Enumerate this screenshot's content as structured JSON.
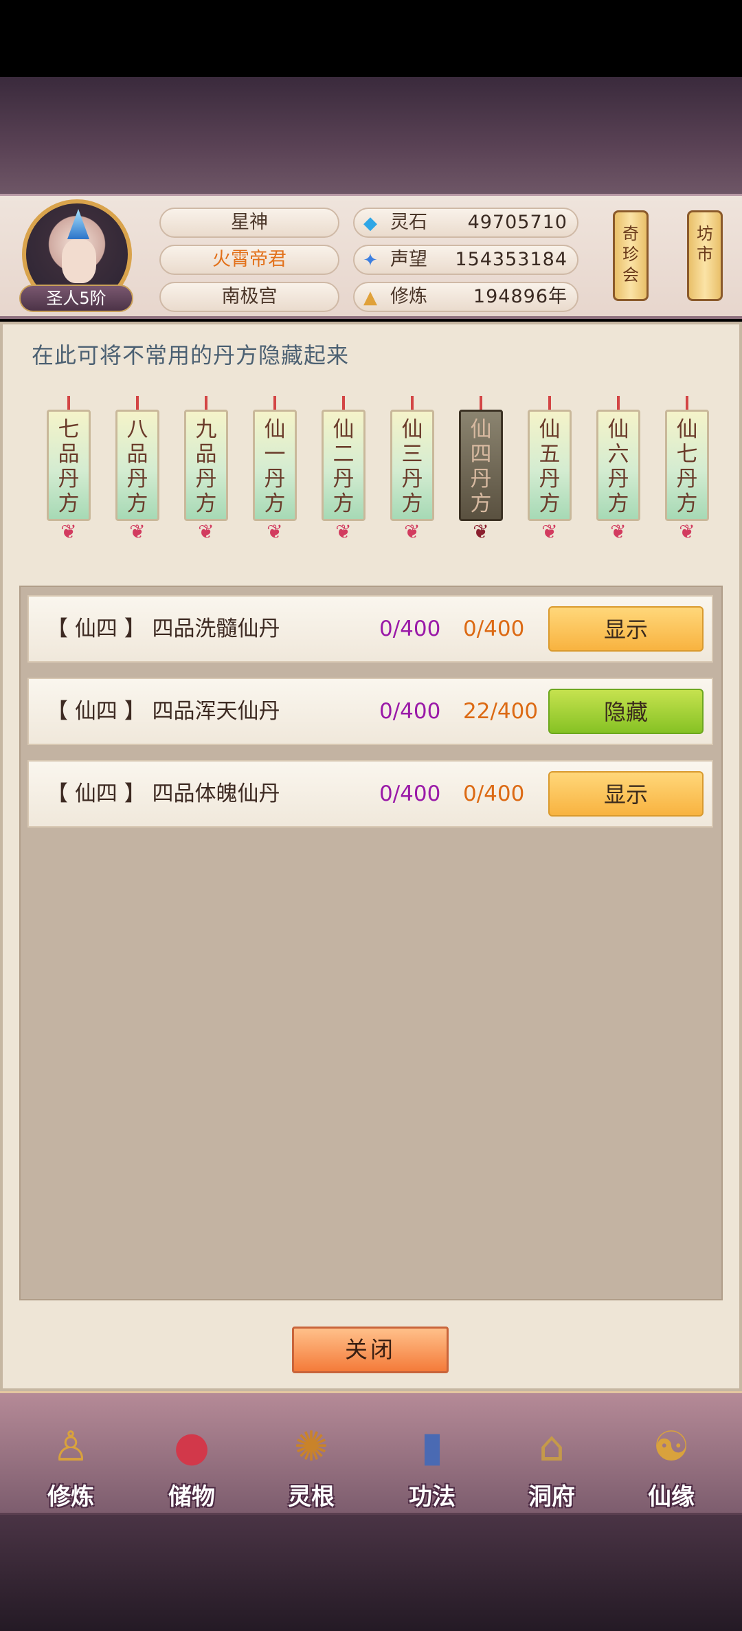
{
  "header": {
    "rank_badge": "圣人5阶",
    "title_name": "星神",
    "player_name": "火霄帝君",
    "sect_name": "南极宫",
    "stats": [
      {
        "icon": "spirit-stone-icon",
        "label": "灵石",
        "value": "49705710"
      },
      {
        "icon": "reputation-icon",
        "label": "声望",
        "value": "154353184"
      },
      {
        "icon": "cultivation-icon",
        "label": "修炼",
        "value": "194896年"
      }
    ],
    "side_buttons": [
      {
        "label": [
          "奇",
          "珍",
          "会"
        ]
      },
      {
        "label": [
          "坊",
          "市"
        ]
      }
    ]
  },
  "panel": {
    "tip": "在此可将不常用的丹方隐藏起来",
    "tabs": [
      {
        "label": [
          "七",
          "品",
          "丹",
          "方"
        ],
        "active": false
      },
      {
        "label": [
          "八",
          "品",
          "丹",
          "方"
        ],
        "active": false
      },
      {
        "label": [
          "九",
          "品",
          "丹",
          "方"
        ],
        "active": false
      },
      {
        "label": [
          "仙",
          "一",
          "丹",
          "方"
        ],
        "active": false
      },
      {
        "label": [
          "仙",
          "二",
          "丹",
          "方"
        ],
        "active": false
      },
      {
        "label": [
          "仙",
          "三",
          "丹",
          "方"
        ],
        "active": false
      },
      {
        "label": [
          "仙",
          "四",
          "丹",
          "方"
        ],
        "active": true
      },
      {
        "label": [
          "仙",
          "五",
          "丹",
          "方"
        ],
        "active": false
      },
      {
        "label": [
          "仙",
          "六",
          "丹",
          "方"
        ],
        "active": false
      },
      {
        "label": [
          "仙",
          "七",
          "丹",
          "方"
        ],
        "active": false
      }
    ],
    "rows": [
      {
        "name": "【 仙四 】 四品洗髓仙丹",
        "a": "0/400",
        "b": "0/400",
        "button": "显示"
      },
      {
        "name": "【 仙四 】 四品浑天仙丹",
        "a": "0/400",
        "b": "22/400",
        "button": "隐藏"
      },
      {
        "name": "【 仙四 】 四品体魄仙丹",
        "a": "0/400",
        "b": "0/400",
        "button": "显示"
      }
    ],
    "close_label": "关闭"
  },
  "nav": [
    {
      "label": "修炼",
      "icon": "meditating-figure-icon"
    },
    {
      "label": "储物",
      "icon": "storage-bag-icon"
    },
    {
      "label": "灵根",
      "icon": "spirit-root-icon"
    },
    {
      "label": "功法",
      "icon": "scripture-book-icon"
    },
    {
      "label": "洞府",
      "icon": "cave-mansion-icon"
    },
    {
      "label": "仙缘",
      "icon": "gourd-icon"
    }
  ],
  "colors": {
    "accent_orange": "#e2711b",
    "count_purple": "#9a1aa8",
    "count_orange": "#dc6a14",
    "show_button": "#f8b340",
    "hide_button": "#86c224"
  }
}
